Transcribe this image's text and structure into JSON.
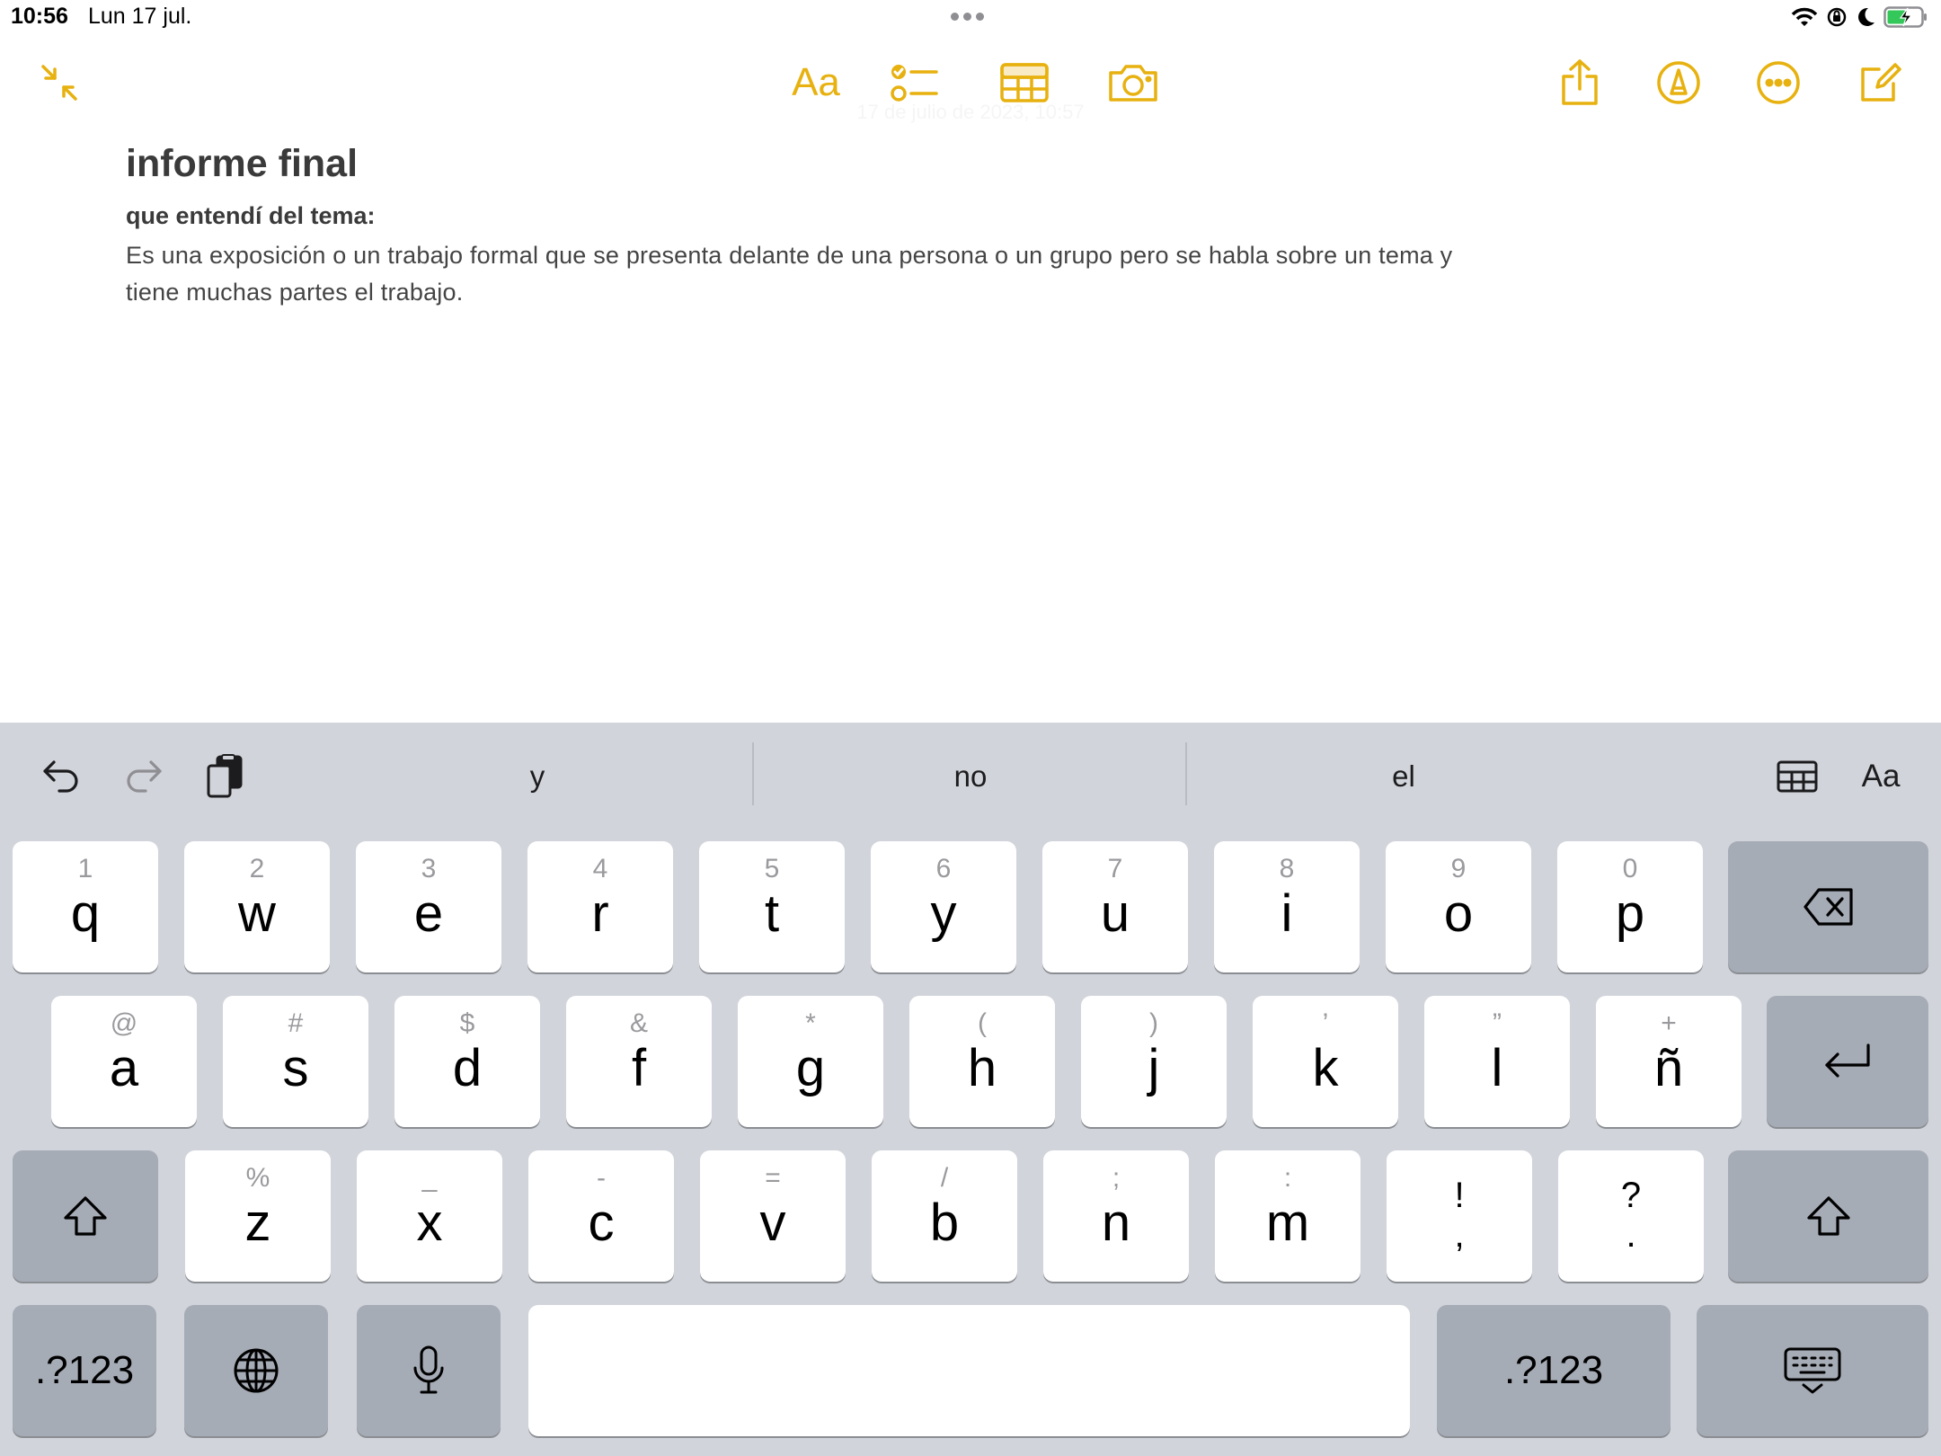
{
  "status": {
    "time": "10:56",
    "date": "Lun 17 jul."
  },
  "toolbar": {
    "format_label": "Aa",
    "ghost_date": "17 de julio de 2023, 10:57",
    "accent_color": "#e7b10f"
  },
  "note": {
    "title": "informe final",
    "subtitle": "que entendí del tema:",
    "body": "Es una exposición o un trabajo formal que se presenta delante de una persona o un grupo pero se habla sobre un tema y tiene muchas partes el trabajo."
  },
  "keyboard": {
    "suggestions": [
      "y",
      "no",
      "el"
    ],
    "format_label": "Aa",
    "row1": [
      {
        "hint": "1",
        "main": "q"
      },
      {
        "hint": "2",
        "main": "w"
      },
      {
        "hint": "3",
        "main": "e"
      },
      {
        "hint": "4",
        "main": "r"
      },
      {
        "hint": "5",
        "main": "t"
      },
      {
        "hint": "6",
        "main": "y"
      },
      {
        "hint": "7",
        "main": "u"
      },
      {
        "hint": "8",
        "main": "i"
      },
      {
        "hint": "9",
        "main": "o"
      },
      {
        "hint": "0",
        "main": "p"
      }
    ],
    "row2": [
      {
        "hint": "@",
        "main": "a"
      },
      {
        "hint": "#",
        "main": "s"
      },
      {
        "hint": "$",
        "main": "d"
      },
      {
        "hint": "&",
        "main": "f"
      },
      {
        "hint": "*",
        "main": "g"
      },
      {
        "hint": "(",
        "main": "h"
      },
      {
        "hint": ")",
        "main": "j"
      },
      {
        "hint": "’",
        "main": "k"
      },
      {
        "hint": "”",
        "main": "l"
      },
      {
        "hint": "+",
        "main": "ñ"
      }
    ],
    "row3": [
      {
        "hint": "%",
        "main": "z"
      },
      {
        "hint": "_",
        "main": "x"
      },
      {
        "hint": "-",
        "main": "c"
      },
      {
        "hint": "=",
        "main": "v"
      },
      {
        "hint": "/",
        "main": "b"
      },
      {
        "hint": ";",
        "main": "n"
      },
      {
        "hint": ":",
        "main": "m"
      }
    ],
    "punct1": {
      "top": "!",
      "bottom": ","
    },
    "punct2": {
      "top": "?",
      "bottom": "."
    },
    "numbers_label": ".?123"
  }
}
